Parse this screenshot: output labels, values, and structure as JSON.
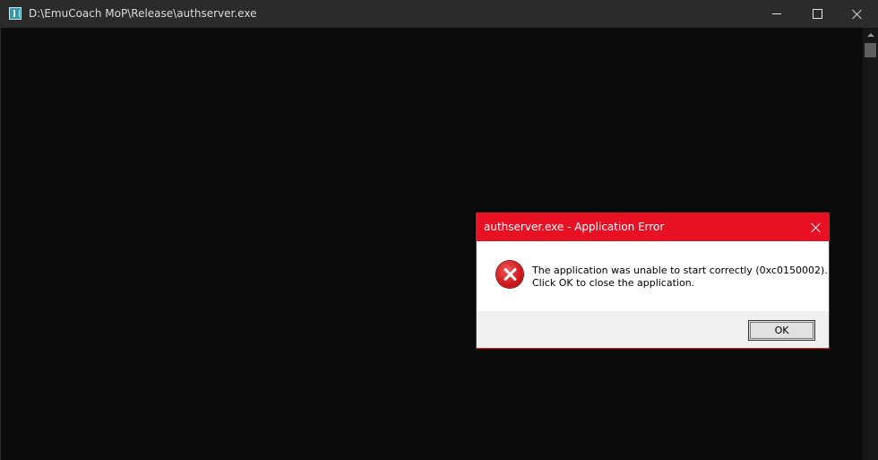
{
  "console": {
    "title": "D:\\EmuCoach MoP\\Release\\authserver.exe"
  },
  "dialog": {
    "title": "authserver.exe - Application Error",
    "message_line1": "The application was unable to start correctly (0xc0150002).",
    "message_line2": "Click OK to close the application.",
    "ok_label": "OK"
  },
  "colors": {
    "console_bg": "#0c0c0c",
    "titlebar_bg": "#2b2b2b",
    "dialog_accent": "#e81123"
  },
  "icons": {
    "app": "console-app-icon",
    "error": "error-icon"
  }
}
